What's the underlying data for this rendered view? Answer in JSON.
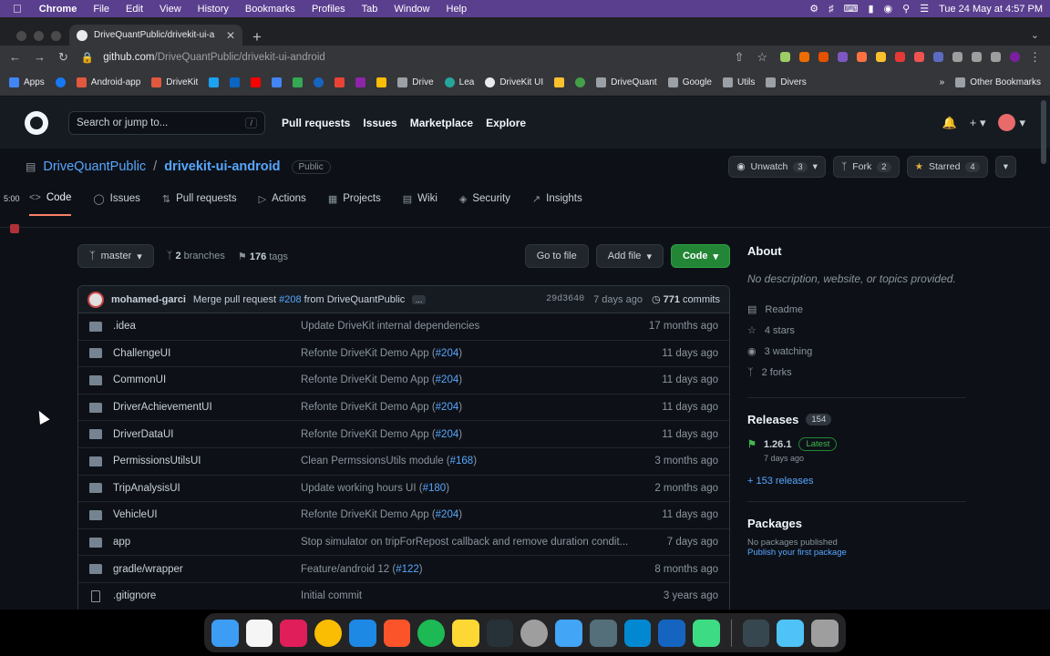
{
  "menubar": {
    "app": "Chrome",
    "items": [
      "File",
      "Edit",
      "View",
      "History",
      "Bookmarks",
      "Profiles",
      "Tab",
      "Window",
      "Help"
    ],
    "clock": "Tue 24 May at 4:57 PM"
  },
  "browser": {
    "tab_title": "DriveQuantPublic/drivekit-ui-a",
    "url_host": "github.com",
    "url_path": "/DriveQuantPublic/drivekit-ui-android",
    "bookmarks": [
      "Apps",
      "Android-app",
      "DriveKit",
      "Drive",
      "Lea",
      "DriveKit UI",
      "DriveQuant",
      "Google",
      "Utils",
      "Divers"
    ],
    "other_bookmarks": "Other Bookmarks"
  },
  "github": {
    "search_placeholder": "Search or jump to...",
    "search_key": "/",
    "nav": [
      "Pull requests",
      "Issues",
      "Marketplace",
      "Explore"
    ]
  },
  "repo": {
    "owner": "DriveQuantPublic",
    "separator": "/",
    "name": "drivekit-ui-android",
    "visibility": "Public",
    "unwatch_label": "Unwatch",
    "unwatch_count": "3",
    "fork_label": "Fork",
    "fork_count": "2",
    "starred_label": "Starred",
    "starred_count": "4",
    "tabs": [
      "Code",
      "Issues",
      "Pull requests",
      "Actions",
      "Projects",
      "Wiki",
      "Security",
      "Insights"
    ]
  },
  "overlay": {
    "timer": "5:00"
  },
  "branchbar": {
    "branch": "master",
    "branches_count": "2",
    "branches_label": "branches",
    "tags_count": "176",
    "tags_label": "tags",
    "go_to_file": "Go to file",
    "add_file": "Add file",
    "code": "Code"
  },
  "commit": {
    "author": "mohamed-garci",
    "message_prefix": "Merge pull request",
    "pr_link": "#208",
    "message_rest": "from DriveQuantPublic/hotfix/app-de...",
    "more": "...",
    "hash": "29d3640",
    "when": "7 days ago",
    "commits_count": "771",
    "commits_label": "commits"
  },
  "files": [
    {
      "name": ".idea",
      "msg": "Update DriveKit internal dependencies",
      "link": "",
      "age": "17 months ago",
      "type": "dir"
    },
    {
      "name": "ChallengeUI",
      "msg": "Refonte DriveKit Demo App (",
      "link": "#204",
      "age": "11 days ago",
      "type": "dir"
    },
    {
      "name": "CommonUI",
      "msg": "Refonte DriveKit Demo App (",
      "link": "#204",
      "age": "11 days ago",
      "type": "dir"
    },
    {
      "name": "DriverAchievementUI",
      "msg": "Refonte DriveKit Demo App (",
      "link": "#204",
      "age": "11 days ago",
      "type": "dir"
    },
    {
      "name": "DriverDataUI",
      "msg": "Refonte DriveKit Demo App (",
      "link": "#204",
      "age": "11 days ago",
      "type": "dir"
    },
    {
      "name": "PermissionsUtilsUI",
      "msg": "Clean PermssionsUtils module (",
      "link": "#168",
      "age": "3 months ago",
      "type": "dir"
    },
    {
      "name": "TripAnalysisUI",
      "msg": "Update working hours UI (",
      "link": "#180",
      "age": "2 months ago",
      "type": "dir"
    },
    {
      "name": "VehicleUI",
      "msg": "Refonte DriveKit Demo App (",
      "link": "#204",
      "age": "11 days ago",
      "type": "dir"
    },
    {
      "name": "app",
      "msg": "Stop simulator on tripForRepost callback and remove duration condit...",
      "link": "",
      "age": "7 days ago",
      "type": "dir"
    },
    {
      "name": "gradle/wrapper",
      "msg": "Feature/android 12 (",
      "link": "#122",
      "age": "8 months ago",
      "type": "dir"
    },
    {
      "name": ".gitignore",
      "msg": "Initial commit",
      "link": "",
      "age": "3 years ago",
      "type": "file"
    }
  ],
  "about": {
    "title": "About",
    "description": "No description, website, or topics provided.",
    "readme": "Readme",
    "stars": "4 stars",
    "watching": "3 watching",
    "forks": "2 forks"
  },
  "releases": {
    "title": "Releases",
    "count": "154",
    "latest_tag": "1.26.1",
    "latest_badge": "Latest",
    "latest_date": "7 days ago",
    "more_link": "+ 153 releases"
  },
  "packages": {
    "title": "Packages",
    "none": "No packages published",
    "publish_link": "Publish your first package"
  },
  "colors": {
    "page_bg": "#0d1117",
    "header_bg": "#161b22",
    "link": "#58a6ff",
    "green_button": "#238636",
    "active_tab_underline": "#f78166",
    "menubar": "#5a3f8f"
  }
}
